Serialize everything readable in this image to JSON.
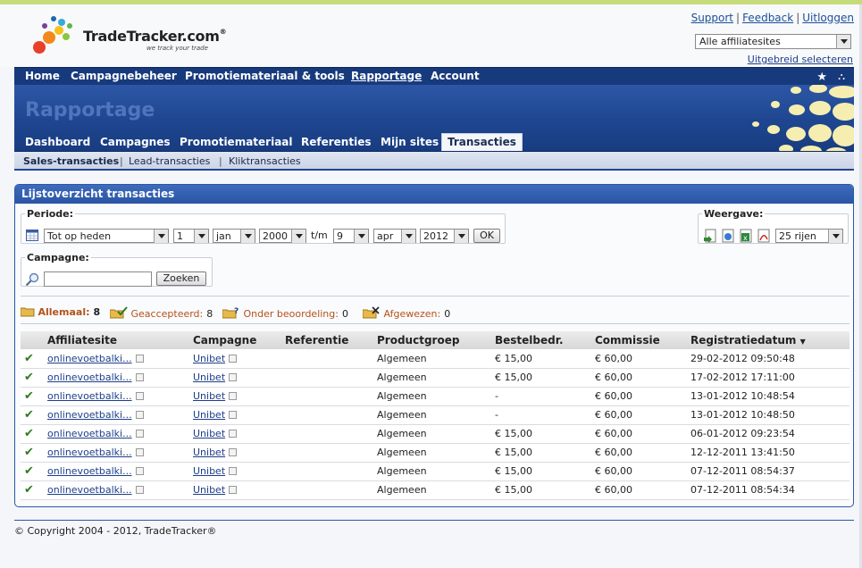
{
  "brand": {
    "name": "TradeTracker.com",
    "suffix": "®",
    "tagline": "we track your trade"
  },
  "toplinks": [
    "Support",
    "Feedback",
    "Uitloggen"
  ],
  "site_select": {
    "value": "Alle affiliatesites"
  },
  "advanced_link": "Uitgebreid selecteren",
  "mainnav": [
    "Home",
    "Campagnebeheer",
    "Promotiemateriaal & tools",
    "Rapportage",
    "Account"
  ],
  "mainnav_active": "Rapportage",
  "section_title": "Rapportage",
  "subnav": [
    "Dashboard",
    "Campagnes",
    "Promotiemateriaal",
    "Referenties",
    "Mijn sites",
    "Transacties"
  ],
  "subnav_active": "Transacties",
  "tertnav": [
    "Sales-transacties",
    "Lead-transacties",
    "Kliktransacties"
  ],
  "panel_title": "Lijstoverzicht transacties",
  "period": {
    "legend": "Periode:",
    "range": "Tot op heden",
    "from_day": "1",
    "from_month": "jan",
    "from_year": "2000",
    "tm": "t/m",
    "to_day": "9",
    "to_month": "apr",
    "to_year": "2012",
    "ok": "OK"
  },
  "view": {
    "legend": "Weergave:",
    "rows": "25 rijen"
  },
  "campaign": {
    "legend": "Campagne:",
    "search_value": "",
    "search_button": "Zoeken"
  },
  "status": [
    {
      "label": "Allemaal:",
      "count": "8"
    },
    {
      "label": "Geaccepteerd:",
      "count": "8"
    },
    {
      "label": "Onder beoordeling:",
      "count": "0"
    },
    {
      "label": "Afgewezen:",
      "count": "0"
    }
  ],
  "table": {
    "headers": [
      "Affiliatesite",
      "Campagne",
      "Referentie",
      "Productgroep",
      "Bestelbedr.",
      "Commissie",
      "Registratiedatum"
    ],
    "rows": [
      {
        "site": "onlinevoetbalki...",
        "campaign": "Unibet",
        "ref": "",
        "group": "Algemeen",
        "amount": "€ 15,00",
        "commission": "€ 60,00",
        "date": "29-02-2012 09:50:48"
      },
      {
        "site": "onlinevoetbalki...",
        "campaign": "Unibet",
        "ref": "",
        "group": "Algemeen",
        "amount": "€ 15,00",
        "commission": "€ 60,00",
        "date": "17-02-2012 17:11:00"
      },
      {
        "site": "onlinevoetbalki...",
        "campaign": "Unibet",
        "ref": "",
        "group": "Algemeen",
        "amount": "-",
        "commission": "€ 60,00",
        "date": "13-01-2012 10:48:54"
      },
      {
        "site": "onlinevoetbalki...",
        "campaign": "Unibet",
        "ref": "",
        "group": "Algemeen",
        "amount": "-",
        "commission": "€ 60,00",
        "date": "13-01-2012 10:48:50"
      },
      {
        "site": "onlinevoetbalki...",
        "campaign": "Unibet",
        "ref": "",
        "group": "Algemeen",
        "amount": "€ 15,00",
        "commission": "€ 60,00",
        "date": "06-01-2012 09:23:54"
      },
      {
        "site": "onlinevoetbalki...",
        "campaign": "Unibet",
        "ref": "",
        "group": "Algemeen",
        "amount": "€ 15,00",
        "commission": "€ 60,00",
        "date": "12-12-2011 13:41:50"
      },
      {
        "site": "onlinevoetbalki...",
        "campaign": "Unibet",
        "ref": "",
        "group": "Algemeen",
        "amount": "€ 15,00",
        "commission": "€ 60,00",
        "date": "07-12-2011 08:54:37"
      },
      {
        "site": "onlinevoetbalki...",
        "campaign": "Unibet",
        "ref": "",
        "group": "Algemeen",
        "amount": "€ 15,00",
        "commission": "€ 60,00",
        "date": "07-12-2011 08:54:34"
      }
    ]
  },
  "footer": "© Copyright 2004 - 2012, TradeTracker®",
  "colors": {
    "nav": "#173a7c",
    "banner": "#1e4690",
    "accent_status": "#b4521a",
    "check": "#2d7a1c",
    "link": "#1c3f8a"
  }
}
